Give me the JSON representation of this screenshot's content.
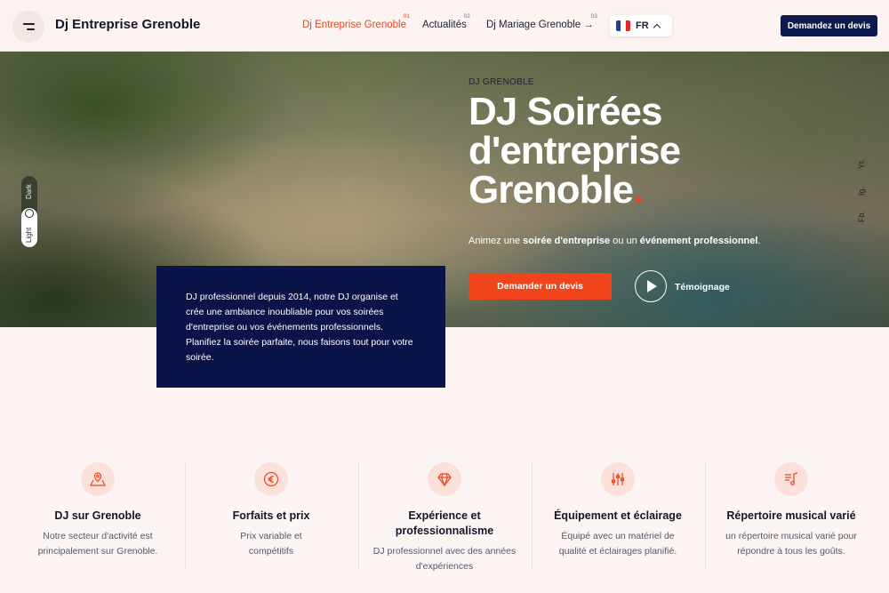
{
  "header": {
    "brand": "Dj Entreprise Grenoble",
    "nav": [
      {
        "label": "Dj Entreprise Grenoble",
        "num": "01"
      },
      {
        "label": "Actualités",
        "num": "02"
      },
      {
        "label": "Dj Mariage Grenoble →",
        "num": "03"
      }
    ],
    "lang": "FR",
    "quote_button": "Demandez un devis"
  },
  "theme_toggle": {
    "dark": "Dark",
    "light": "Light"
  },
  "hero": {
    "eyebrow": "DJ GRENOBLE",
    "title_line1": "DJ Soirées",
    "title_line2": "d'entreprise",
    "title_line3": "Grenoble",
    "title_dot": ".",
    "subtitle_pre": "Animez une ",
    "subtitle_bold1": "soirée d'entreprise",
    "subtitle_mid": " ou un ",
    "subtitle_bold2": "événement professionnel",
    "subtitle_post": ".",
    "cta": "Demander un devis",
    "play_label": "Témoignage",
    "socials": [
      "Yt.",
      "Ig.",
      "Fb."
    ]
  },
  "intro": {
    "text": "DJ professionnel depuis 2014, notre DJ organise et crée une ambiance inoubliable pour vos soirées d'entreprise ou vos événements professionnels. Planifiez la soirée parfaite, nous faisons tout pour votre soirée."
  },
  "features": [
    {
      "icon": "map-icon",
      "title": "DJ sur Grenoble",
      "text": "Notre secteur d'activité est principalement sur Grenoble."
    },
    {
      "icon": "euro-icon",
      "title": "Forfaits et prix",
      "text": "Prix variable et compétitifs"
    },
    {
      "icon": "diamond-icon",
      "title": "Expérience et professionnalisme",
      "text": "DJ professionnel avec des années d'expériences"
    },
    {
      "icon": "sliders-icon",
      "title": "Équipement et éclairage",
      "text": "Équipé avec un matériel de qualité et éclairages planifié."
    },
    {
      "icon": "music-note-icon",
      "title": "Répertoire musical varié",
      "text": "un répertoire musical varié pour répondre à tous les goûts."
    }
  ],
  "colors": {
    "accent": "#e8461e",
    "navy": "#0b1449",
    "background": "#fdf4f2"
  }
}
